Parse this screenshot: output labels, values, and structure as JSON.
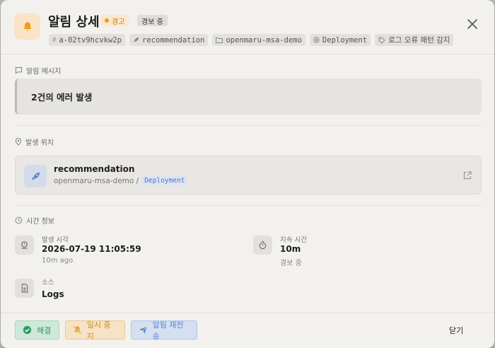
{
  "page_top_fragment": "‧ ‧‧‧‧‧‧‧‧‧‧‧‧‧‧‧",
  "page_top_right_fragment": "‧‧‧‧",
  "header": {
    "title": "알림 상세",
    "severity_badge": "경고",
    "state_badge": "경보 중",
    "chips": [
      {
        "icon": "hash-icon",
        "text": "a-02tv9hcvkw2p"
      },
      {
        "icon": "rocket-icon",
        "text": "recommendation"
      },
      {
        "icon": "folder-icon",
        "text": "openmaru-msa-demo"
      },
      {
        "icon": "cube-icon",
        "text": "Deployment"
      },
      {
        "icon": "tag-icon",
        "text": "로그 오류 패턴 감지"
      }
    ]
  },
  "message_section": {
    "label": "알림 메시지",
    "text": "2건의 에러 발생"
  },
  "location_section": {
    "label": "발생 위치",
    "name": "recommendation",
    "namespace": "openmaru-msa-demo /",
    "kind": "Deployment"
  },
  "time_section": {
    "label": "시간 정보",
    "occurred": {
      "label": "발생 시각",
      "value": "2026-07-19 11:05:59",
      "sub": "10m ago"
    },
    "duration": {
      "label": "지속 시간",
      "value": "10m",
      "sub": "경보 중"
    },
    "source": {
      "label": "소스",
      "value": "Logs"
    }
  },
  "footer": {
    "resolve_label": "해결",
    "snooze_label": "일시 중지",
    "resend_label": "알림 재전송",
    "close_label": "닫기"
  },
  "colors": {
    "warning": "#f09a1f",
    "success": "#2c9c5e",
    "info": "#5b87cf"
  }
}
